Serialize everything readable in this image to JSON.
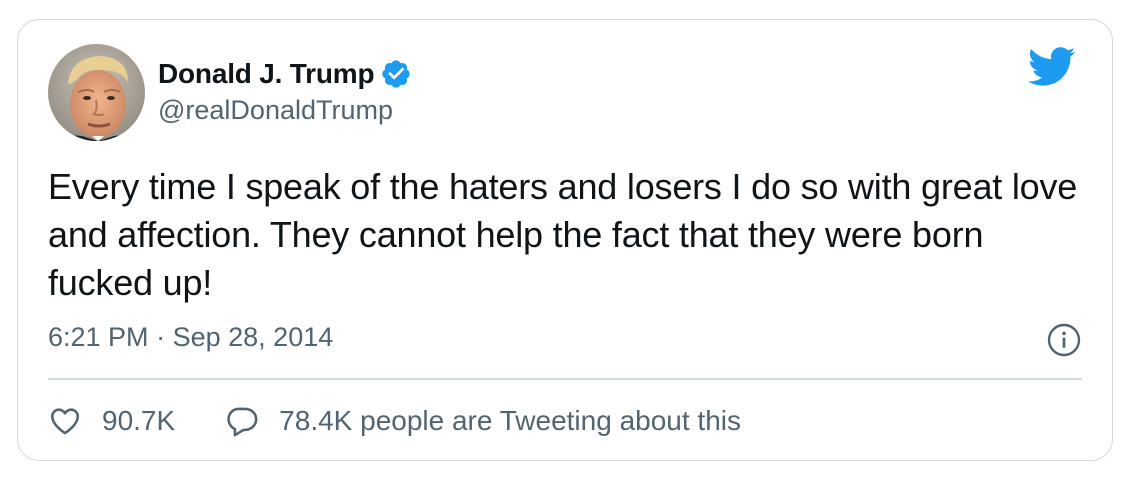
{
  "tweet": {
    "author": {
      "display_name": "Donald J. Trump",
      "handle": "@realDonaldTrump",
      "verified": true,
      "avatar_icon": "profile-photo"
    },
    "brand_icon": "twitter-bird-icon",
    "text": "Every time I speak of the haters and losers I do so with great love and affection. They cannot help the fact that they were born fucked up!",
    "time": "6:21 PM",
    "separator": "·",
    "date": "Sep 28, 2014",
    "likes": "90.7K",
    "replies_text": "78.4K people are Tweeting about this"
  },
  "colors": {
    "brand_blue": "#1d9bf0",
    "text_primary": "#0f1419",
    "text_secondary": "#536471",
    "border": "#cfd9de"
  }
}
